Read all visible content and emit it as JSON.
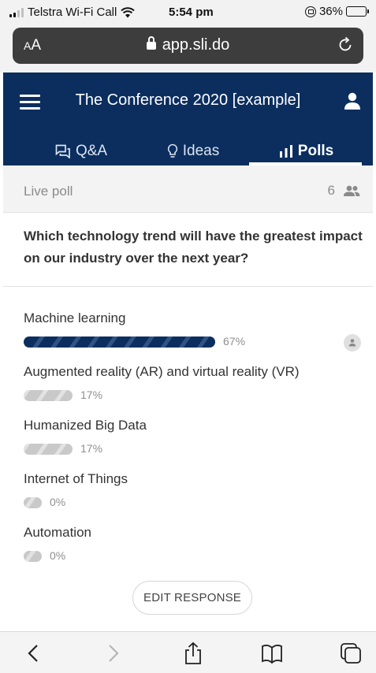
{
  "status_bar": {
    "carrier": "Telstra Wi-Fi Call",
    "time": "5:54 pm",
    "battery": "36%",
    "battery_level": 0.36
  },
  "browser": {
    "text_size_label": "AA",
    "url": "app.sli.do"
  },
  "header": {
    "title": "The Conference 2020 [example]",
    "tabs": [
      {
        "label": "Q&A",
        "icon": "chat-bubbles-icon"
      },
      {
        "label": "Ideas",
        "icon": "lightbulb-icon"
      },
      {
        "label": "Polls",
        "icon": "bar-chart-icon",
        "active": true
      }
    ]
  },
  "poll": {
    "status_label": "Live poll",
    "participants": "6",
    "question": "Which technology trend will have the greatest impact on our industry over the next year?",
    "options": [
      {
        "label": "Machine learning",
        "percent": "67%",
        "value": 0.67,
        "selected": true
      },
      {
        "label": "Augmented reality (AR) and virtual reality (VR)",
        "percent": "17%",
        "value": 0.17
      },
      {
        "label": "Humanized Big Data",
        "percent": "17%",
        "value": 0.17
      },
      {
        "label": "Internet of Things",
        "percent": "0%",
        "value": 0
      },
      {
        "label": "Automation",
        "percent": "0%",
        "value": 0
      }
    ],
    "edit_button": "EDIT RESPONSE"
  },
  "colors": {
    "brand_navy": "#0b2e5f",
    "bar_gray": "#c9c9c9"
  }
}
